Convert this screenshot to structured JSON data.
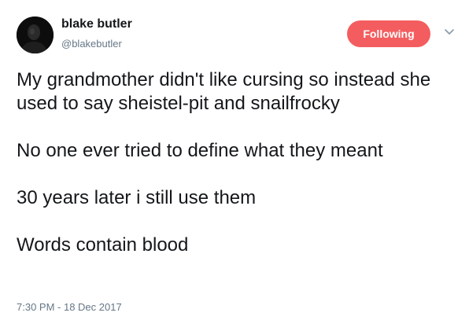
{
  "author": {
    "display_name": "blake butler",
    "handle": "@blakebutler",
    "avatar_icon": "user-avatar-photo"
  },
  "follow_button": {
    "label": "Following",
    "color": "#f45d5f"
  },
  "menu": {
    "icon": "chevron-down-icon"
  },
  "tweet": {
    "paragraphs": [
      "My grandmother didn't like cursing so instead she used to say sheistel-pit and snailfrocky",
      "No one ever tried to define what they meant",
      "30 years later i still use them",
      "Words contain blood"
    ],
    "timestamp": "7:30 PM - 18 Dec 2017"
  },
  "colors": {
    "text": "#14171a",
    "secondary_text": "#657786"
  }
}
